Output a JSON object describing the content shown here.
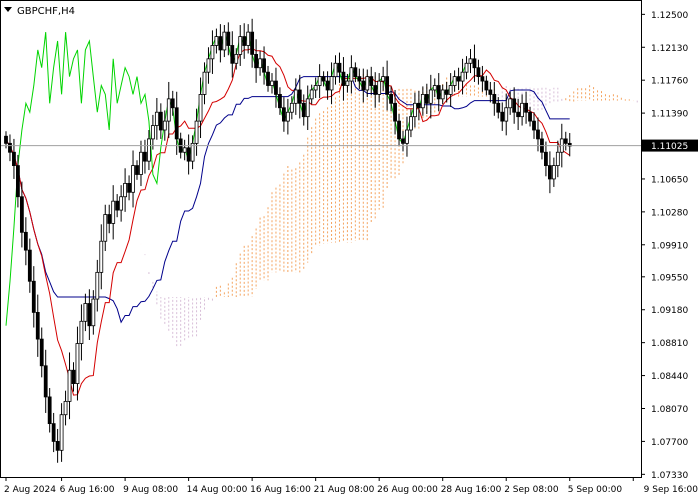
{
  "symbol_label": "GBPCHF,H4",
  "colors": {
    "background": "#ffffff",
    "frame": "#000000",
    "candle_up_fill": "#ffffff",
    "candle_down_fill": "#000000",
    "candle_line": "#000000",
    "tenkan": "#d40000",
    "kijun": "#00008b",
    "chikou": "#00d400",
    "span_a": "#f4a460",
    "span_b": "#d8bfd8",
    "last_price_line": "#a0a0a0",
    "last_price_tag": "#000000"
  },
  "chart_data": {
    "type": "candlestick",
    "title": "GBPCHF,H4",
    "indicator": "Ichimoku Kinko Hyo",
    "ylim": [
      1.073,
      1.1265
    ],
    "y_ticks": [
      "1.12500",
      "1.12130",
      "1.11760",
      "1.11390",
      "1.11025",
      "1.10650",
      "1.10280",
      "1.09910",
      "1.09550",
      "1.09180",
      "1.08810",
      "1.08440",
      "1.08070",
      "1.07700",
      "1.07330"
    ],
    "x_ticks": [
      {
        "label": "2 Aug 2024",
        "bar": 0
      },
      {
        "label": "6 Aug 16:00",
        "bar": 14
      },
      {
        "label": "9 Aug 08:00",
        "bar": 30
      },
      {
        "label": "14 Aug 00:00",
        "bar": 46
      },
      {
        "label": "16 Aug 16:00",
        "bar": 62
      },
      {
        "label": "21 Aug 08:00",
        "bar": 78
      },
      {
        "label": "26 Aug 00:00",
        "bar": 94
      },
      {
        "label": "28 Aug 16:00",
        "bar": 110
      },
      {
        "label": "2 Sep 08:00",
        "bar": 126
      },
      {
        "label": "5 Sep 00:00",
        "bar": 142
      },
      {
        "label": "9 Sep 16:00",
        "bar": 158
      }
    ],
    "last_price": "1.11025",
    "close_series": [
      1.1105,
      1.1095,
      1.108,
      1.1045,
      1.1005,
      1.0985,
      1.095,
      1.0915,
      1.0885,
      1.0855,
      1.082,
      1.079,
      1.077,
      1.076,
      1.08,
      1.0815,
      1.085,
      1.0835,
      1.088,
      1.0905,
      1.0925,
      1.09,
      1.093,
      1.096,
      1.0995,
      1.1025,
      1.1015,
      1.104,
      1.103,
      1.1045,
      1.106,
      1.105,
      1.108,
      1.107,
      1.1095,
      1.1085,
      1.111,
      1.1125,
      1.114,
      1.112,
      1.113,
      1.1155,
      1.1145,
      1.111,
      1.1095,
      1.11,
      1.1085,
      1.1105,
      1.113,
      1.116,
      1.1185,
      1.12,
      1.1215,
      1.1225,
      1.121,
      1.123,
      1.1215,
      1.1195,
      1.1205,
      1.1225,
      1.1215,
      1.123,
      1.1205,
      1.119,
      1.12,
      1.1185,
      1.117,
      1.1175,
      1.116,
      1.1145,
      1.113,
      1.114,
      1.115,
      1.1165,
      1.115,
      1.1135,
      1.1155,
      1.1165,
      1.117,
      1.118,
      1.1175,
      1.1165,
      1.118,
      1.1195,
      1.1185,
      1.117,
      1.1175,
      1.119,
      1.118,
      1.1175,
      1.1165,
      1.118,
      1.117,
      1.116,
      1.1175,
      1.118,
      1.116,
      1.115,
      1.113,
      1.111,
      1.1105,
      1.112,
      1.1135,
      1.115,
      1.1145,
      1.116,
      1.115,
      1.1165,
      1.117,
      1.1155,
      1.1165,
      1.116,
      1.117,
      1.118,
      1.1175,
      1.1185,
      1.1195,
      1.12,
      1.119,
      1.118,
      1.1175,
      1.1165,
      1.116,
      1.115,
      1.114,
      1.113,
      1.1145,
      1.1155,
      1.114,
      1.1135,
      1.115,
      1.114,
      1.113,
      1.112,
      1.111,
      1.1095,
      1.108,
      1.1065,
      1.108,
      1.1095,
      1.111,
      1.1105,
      1.1102
    ],
    "chikou_series": [
      1.09,
      1.095,
      1.101,
      1.108,
      1.112,
      1.115,
      1.114,
      1.117,
      1.121,
      1.119,
      1.123,
      1.115,
      1.119,
      1.122,
      1.116,
      1.123,
      1.118,
      1.12,
      1.121,
      1.115,
      1.121,
      1.122,
      1.118,
      1.114,
      1.117,
      1.116,
      1.112,
      1.12,
      1.115,
      1.117,
      1.119,
      1.118,
      1.116,
      1.118,
      1.115,
      1.116,
      1.113,
      1.107,
      1.106,
      1.11
    ]
  }
}
